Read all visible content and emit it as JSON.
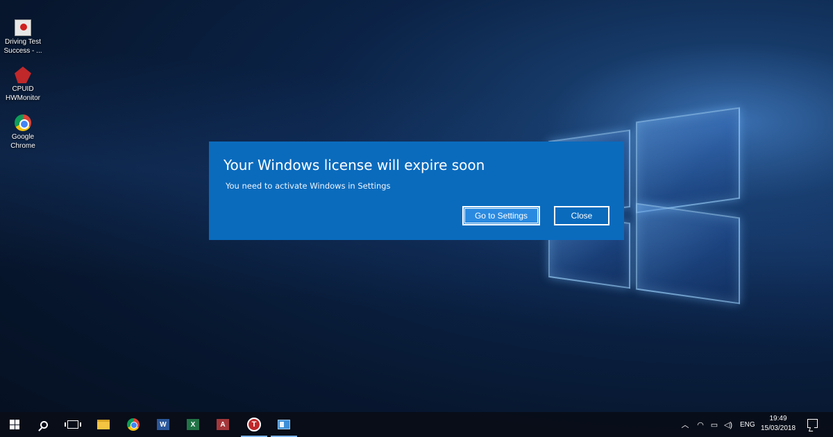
{
  "desktop": {
    "icons": [
      {
        "label": "Driving Test Success - ...",
        "icon": "driving-test-icon"
      },
      {
        "label": "CPUID HWMonitor",
        "icon": "cpuid-icon"
      },
      {
        "label": "Google Chrome",
        "icon": "chrome-icon"
      }
    ]
  },
  "dialog": {
    "title": "Your Windows license will expire soon",
    "message": "You need to activate Windows in Settings",
    "primary_button": "Go to Settings",
    "secondary_button": "Close",
    "background_color": "#0a6bbd"
  },
  "taskbar": {
    "pinned": [
      {
        "name": "start",
        "icon": "windows-logo-icon"
      },
      {
        "name": "search",
        "icon": "search-icon"
      },
      {
        "name": "task-view",
        "icon": "task-view-icon"
      },
      {
        "name": "file-explorer",
        "icon": "folder-icon"
      },
      {
        "name": "chrome",
        "icon": "chrome-icon"
      },
      {
        "name": "word",
        "icon": "word-icon",
        "letter": "W"
      },
      {
        "name": "excel",
        "icon": "excel-icon",
        "letter": "X"
      },
      {
        "name": "access",
        "icon": "access-icon",
        "letter": "A"
      },
      {
        "name": "t-app",
        "icon": "t-app-icon",
        "letter": "T"
      },
      {
        "name": "window-app",
        "icon": "window-app-icon"
      }
    ],
    "tray": {
      "language": "ENG",
      "time": "19:49",
      "date": "15/03/2018"
    }
  }
}
